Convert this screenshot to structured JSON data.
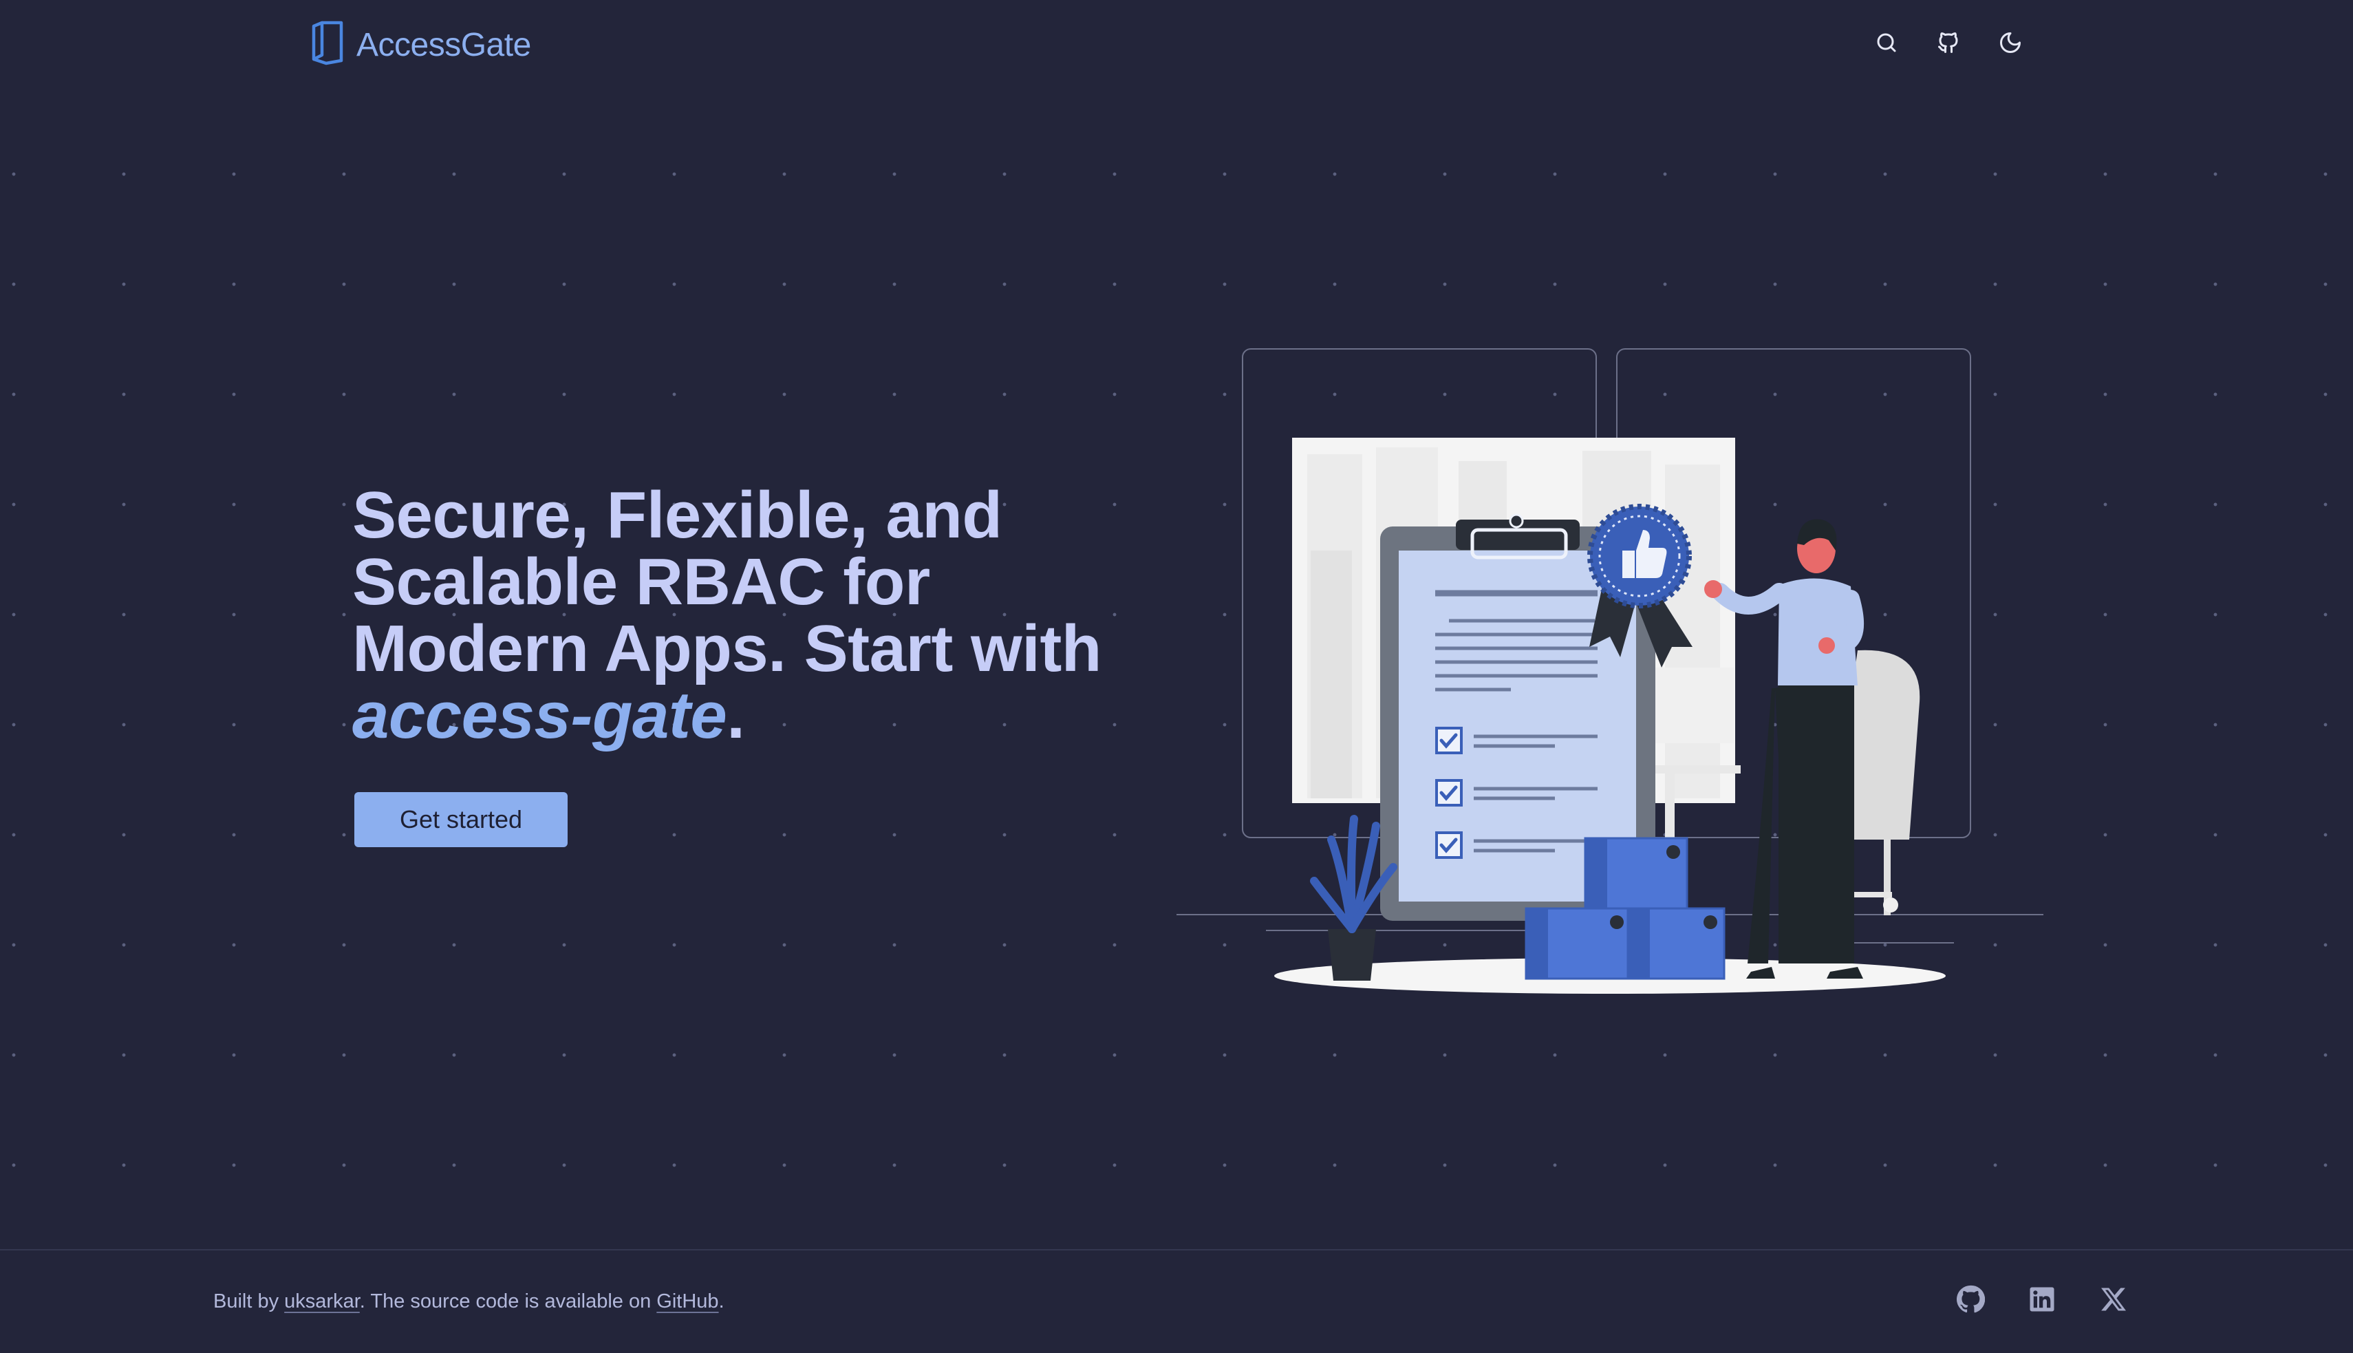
{
  "header": {
    "brand": "AccessGate",
    "icons": [
      "search-icon",
      "github-icon",
      "moon-icon"
    ]
  },
  "hero": {
    "title_line_1": "Secure, Flexible, and",
    "title_line_2": "Scalable RBAC for",
    "title_line_3": "Modern Apps. Start with",
    "title_accent": "access-gate",
    "title_end": ".",
    "cta_label": "Get started"
  },
  "footer": {
    "built_by_prefix": "Built by ",
    "author": "uksarkar",
    "middle_text": ". The source code is available on ",
    "source_link": "GitHub",
    "suffix": ".",
    "icons": [
      "github-icon",
      "linkedin-icon",
      "x-icon"
    ]
  },
  "colors": {
    "background": "#23253a",
    "accent": "#8cafef",
    "text": "#c6cdf7"
  }
}
